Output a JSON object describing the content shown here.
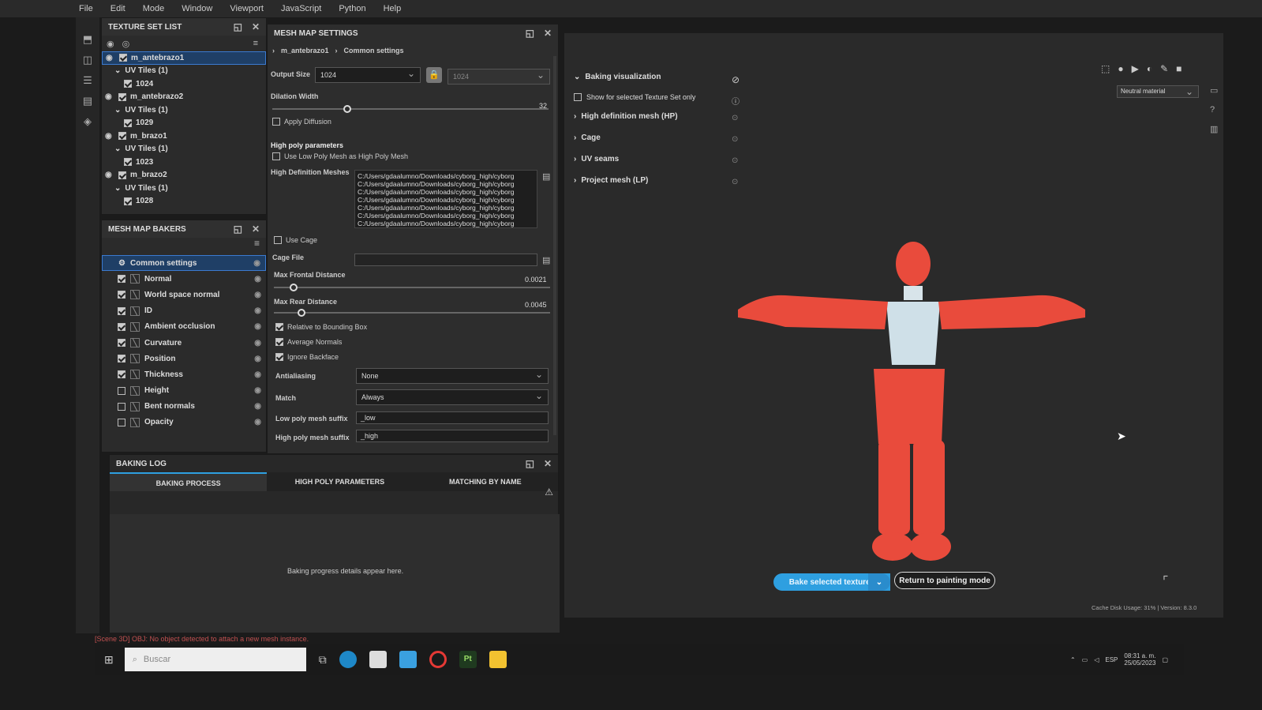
{
  "menu": [
    "File",
    "Edit",
    "Mode",
    "Window",
    "Viewport",
    "JavaScript",
    "Python",
    "Help"
  ],
  "texture_set_list": {
    "title": "TEXTURE SET LIST",
    "rows": [
      {
        "label": "m_antebrazo1",
        "level": 0,
        "selected": true
      },
      {
        "label": "UV Tiles (1)",
        "level": 1
      },
      {
        "label": "1024",
        "level": 2
      },
      {
        "label": "m_antebrazo2",
        "level": 0
      },
      {
        "label": "UV Tiles (1)",
        "level": 1
      },
      {
        "label": "1029",
        "level": 2
      },
      {
        "label": "m_brazo1",
        "level": 0
      },
      {
        "label": "UV Tiles (1)",
        "level": 1
      },
      {
        "label": "1023",
        "level": 2
      },
      {
        "label": "m_brazo2",
        "level": 0
      },
      {
        "label": "UV Tiles (1)",
        "level": 1
      },
      {
        "label": "1028",
        "level": 2
      }
    ]
  },
  "bakers": {
    "title": "MESH MAP BAKERS",
    "common": "Common settings",
    "items": [
      {
        "label": "Normal",
        "checked": true
      },
      {
        "label": "World space normal",
        "checked": true
      },
      {
        "label": "ID",
        "checked": true
      },
      {
        "label": "Ambient occlusion",
        "checked": true
      },
      {
        "label": "Curvature",
        "checked": true
      },
      {
        "label": "Position",
        "checked": true
      },
      {
        "label": "Thickness",
        "checked": true
      },
      {
        "label": "Height",
        "checked": false
      },
      {
        "label": "Bent normals",
        "checked": false
      },
      {
        "label": "Opacity",
        "checked": false
      }
    ]
  },
  "mesh_map": {
    "title": "MESH MAP SETTINGS",
    "crumb1": "m_antebrazo1",
    "crumb2": "Common settings",
    "output_size_label": "Output Size",
    "output_size": "1024",
    "output_size2": "1024",
    "dilation_label": "Dilation Width",
    "dilation_value": "32",
    "apply_diffusion": "Apply Diffusion",
    "high_poly_header": "High poly parameters",
    "use_low_poly": "Use Low Poly Mesh as High Poly Mesh",
    "hd_meshes_label": "High Definition Meshes",
    "hd_meshes": [
      "C:/Users/gdaalumno/Downloads/cyborg_high/cyborg",
      "C:/Users/gdaalumno/Downloads/cyborg_high/cyborg",
      "C:/Users/gdaalumno/Downloads/cyborg_high/cyborg",
      "C:/Users/gdaalumno/Downloads/cyborg_high/cyborg",
      "C:/Users/gdaalumno/Downloads/cyborg_high/cyborg",
      "C:/Users/gdaalumno/Downloads/cyborg_high/cyborg",
      "C:/Users/gdaalumno/Downloads/cyborg_high/cyborg"
    ],
    "use_cage": "Use Cage",
    "cage_file": "Cage File",
    "max_frontal_label": "Max Frontal Distance",
    "max_frontal_value": "0.0021",
    "max_rear_label": "Max Rear Distance",
    "max_rear_value": "0.0045",
    "relative_bbox": "Relative to Bounding Box",
    "average_normals": "Average Normals",
    "ignore_backface": "Ignore Backface",
    "antialiasing_label": "Antialiasing",
    "antialiasing_value": "None",
    "match_label": "Match",
    "match_value": "Always",
    "low_suffix_label": "Low poly mesh suffix",
    "low_suffix_value": "_low",
    "high_suffix_label": "High poly mesh suffix",
    "high_suffix_value": "_high"
  },
  "baking_log": {
    "title": "BAKING LOG",
    "tabs": [
      "BAKING PROCESS",
      "HIGH POLY PARAMETERS",
      "MATCHING BY NAME"
    ],
    "placeholder": "Baking progress details appear here."
  },
  "viewport": {
    "baking_vis": "Baking visualization",
    "show_selected": "Show for selected Texture Set only",
    "sections": [
      "High definition mesh (HP)",
      "Cage",
      "UV seams",
      "Project mesh (LP)"
    ],
    "material_select": "Neutral material",
    "bake_button": "Bake selected textures",
    "return_button": "Return to painting mode",
    "status_right": "Cache Disk Usage:  31% | Version: 8.3.0"
  },
  "status_message": "[Scene 3D] OBJ: No object detected to attach a new mesh instance.",
  "taskbar": {
    "search": "Buscar",
    "time": "08:31 a. m.",
    "date": "25/05/2023",
    "lang": "ESP"
  },
  "colors": {
    "accent": "#2e9fe0",
    "figure_red": "#e94b3c",
    "figure_white": "#d8e4ea"
  }
}
